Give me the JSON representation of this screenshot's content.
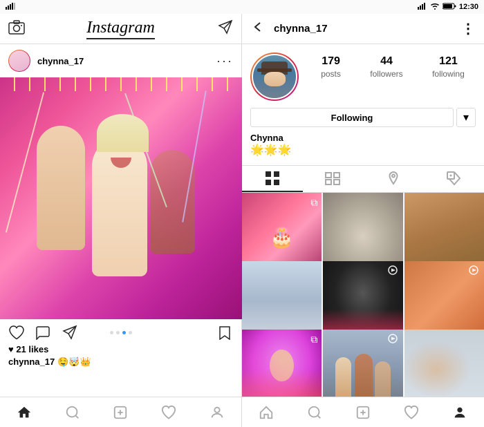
{
  "status": {
    "time": "12:30",
    "left_panel_time": "",
    "right_panel_time": "12:30"
  },
  "left_panel": {
    "header": {
      "title": "Instagram",
      "camera_icon": "camera",
      "send_icon": "send"
    },
    "post": {
      "username": "chynna_17",
      "action_icons": {
        "heart_icon": "heart",
        "comment_icon": "comment",
        "share_icon": "share",
        "bookmark_icon": "bookmark"
      },
      "dots": [
        "inactive",
        "inactive",
        "active",
        "inactive"
      ],
      "likes": "♥ 21 likes",
      "caption_user": "chynna_17",
      "caption_emojis": "🤤🤯👑"
    },
    "bottom_nav": {
      "home_icon": "home",
      "search_icon": "search",
      "add_icon": "add",
      "heart_icon": "heart",
      "profile_icon": "profile"
    }
  },
  "right_panel": {
    "header": {
      "back_icon": "back",
      "username": "chynna_17",
      "more_icon": "more"
    },
    "profile": {
      "stats": {
        "posts_count": "179",
        "posts_label": "posts",
        "followers_count": "44",
        "followers_label": "followers",
        "following_count": "121",
        "following_label": "following"
      },
      "follow_button": "Following",
      "dropdown_icon": "▾",
      "name": "Chynna",
      "bio_emojis": "🌟🌟🌟"
    },
    "tabs": {
      "grid_icon": "grid",
      "list_icon": "list",
      "location_icon": "location",
      "tag_icon": "tag"
    },
    "bottom_nav": {
      "home_icon": "home",
      "search_icon": "search",
      "add_icon": "add",
      "heart_icon": "heart",
      "profile_icon": "profile"
    }
  }
}
